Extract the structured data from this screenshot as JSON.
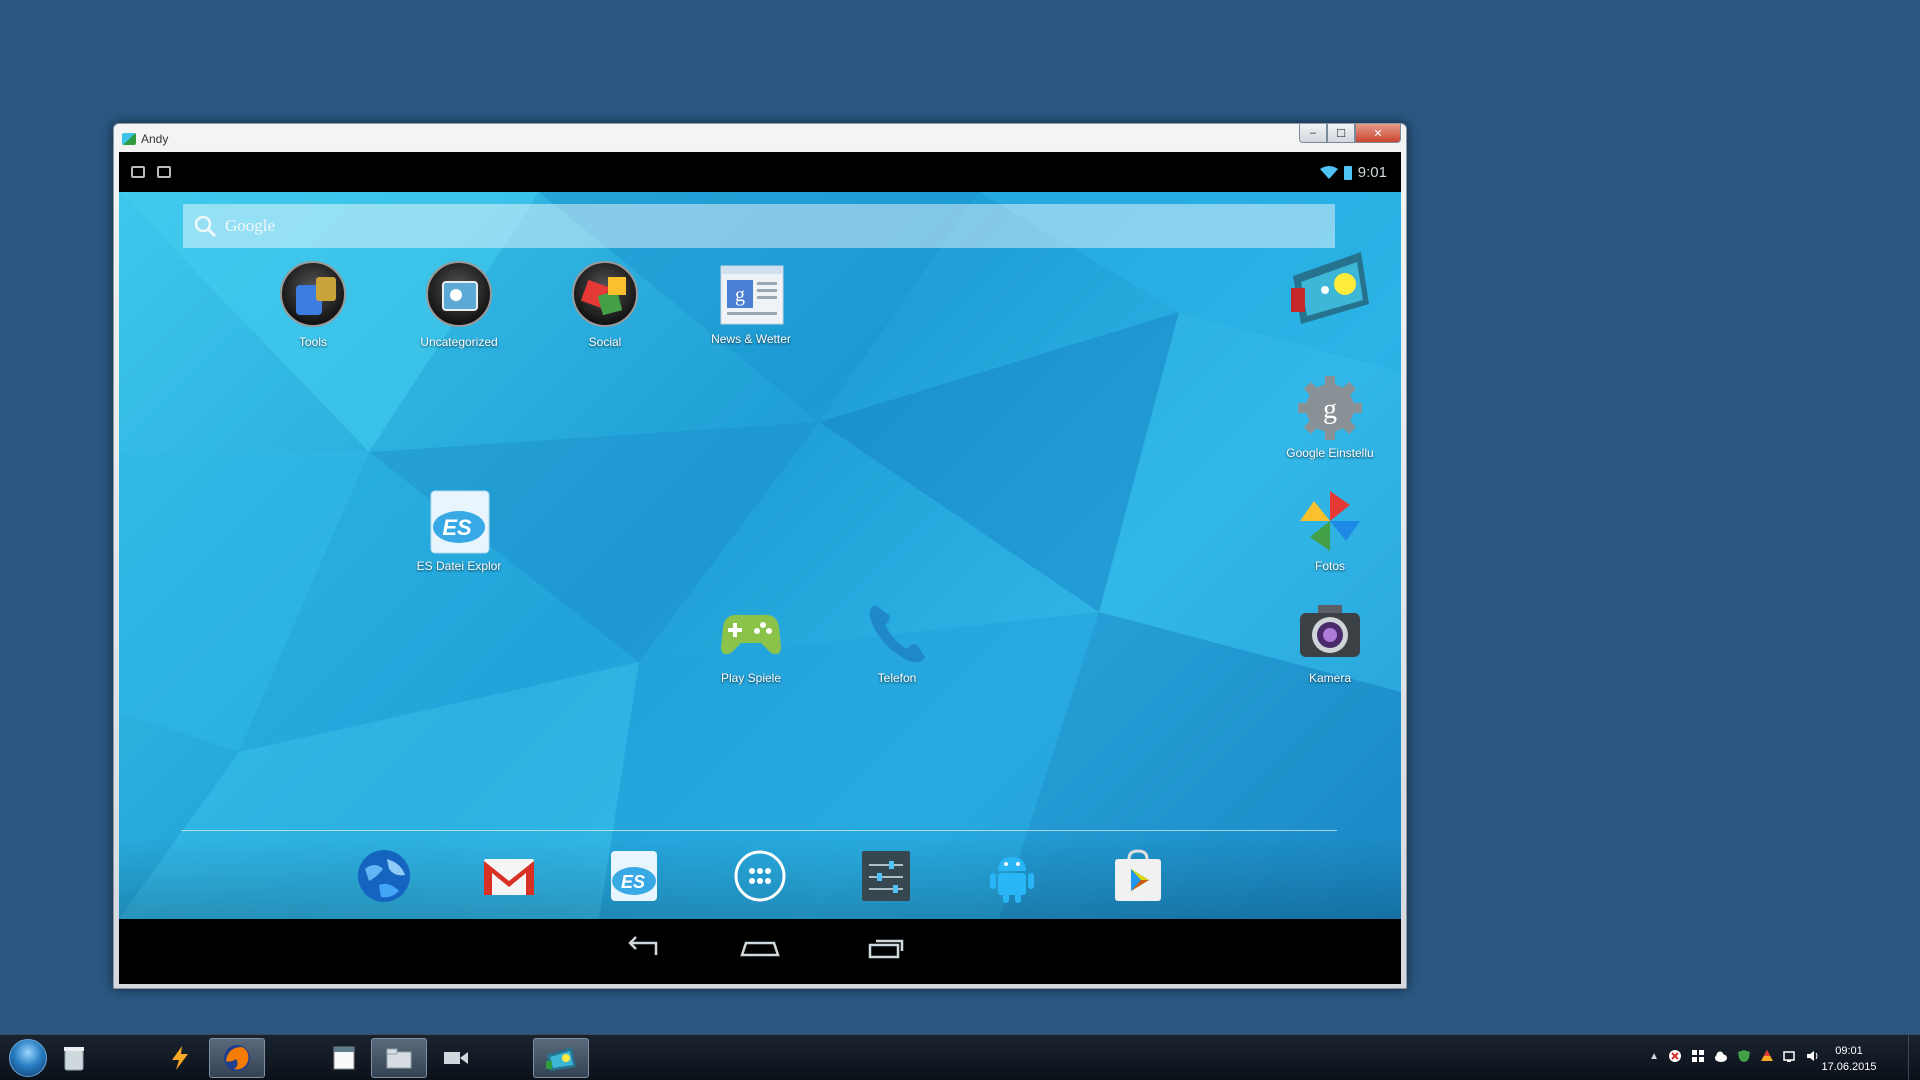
{
  "window": {
    "title": "Andy"
  },
  "window_controls": {
    "minimize": "–",
    "maximize": "☐",
    "close": "✕"
  },
  "statusbar": {
    "time": "9:01"
  },
  "search": {
    "placeholder": "Google"
  },
  "home_icons": [
    {
      "label": "Tools"
    },
    {
      "label": "Uncategorized"
    },
    {
      "label": "Social"
    },
    {
      "label": "News & Wetter"
    },
    {
      "label": "ES Datei Explor"
    },
    {
      "label": "Play Spiele"
    },
    {
      "label": "Telefon"
    },
    {
      "label": "Google Einstellu"
    },
    {
      "label": "Fotos"
    },
    {
      "label": "Kamera"
    }
  ],
  "dock": [
    {
      "icon": "browser-globe-icon"
    },
    {
      "icon": "gmail-icon"
    },
    {
      "icon": "es-file-explorer-icon"
    },
    {
      "icon": "app-drawer-icon"
    },
    {
      "icon": "settings-icon"
    },
    {
      "icon": "android-icon"
    },
    {
      "icon": "play-store-icon"
    }
  ],
  "taskbar": {
    "clock_time": "09:01",
    "clock_date": "17.06.2015"
  },
  "colors": {
    "desktop": "#2b5782",
    "wallpaper_accent": "#1f9fd6",
    "status_accent": "#4fc3f7"
  }
}
